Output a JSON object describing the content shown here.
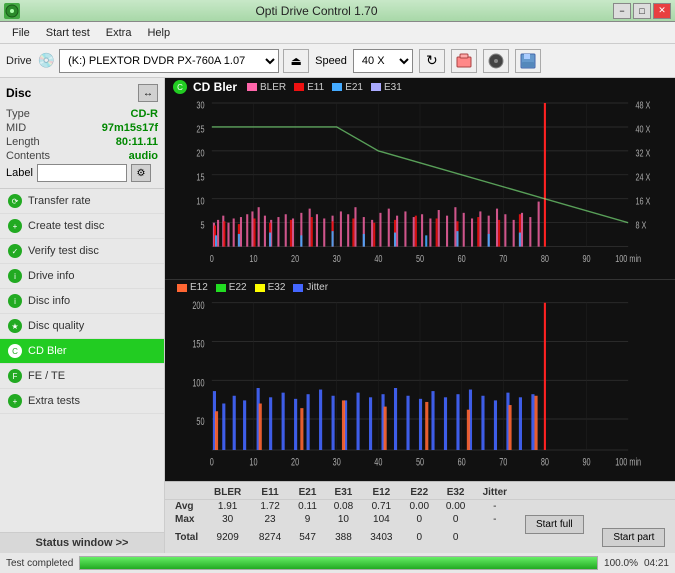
{
  "titlebar": {
    "title": "Opti Drive Control 1.70",
    "icon": "O",
    "min": "−",
    "max": "□",
    "close": "✕"
  },
  "menubar": {
    "items": [
      "File",
      "Start test",
      "Extra",
      "Help"
    ]
  },
  "toolbar": {
    "drive_label": "Drive",
    "drive_icon": "💿",
    "drive_value": "(K:)  PLEXTOR DVDR  PX-760A 1.07",
    "eject_icon": "⏏",
    "speed_label": "Speed",
    "speed_value": "40 X",
    "speed_icon": "↻",
    "copy_icon": "⊙",
    "burn_icon": "🔥",
    "save_icon": "💾"
  },
  "disc": {
    "header": "Disc",
    "refresh_icon": "↔",
    "type_label": "Type",
    "type_value": "CD-R",
    "mid_label": "MID",
    "mid_value": "97m15s17f",
    "length_label": "Length",
    "length_value": "80:11.11",
    "contents_label": "Contents",
    "contents_value": "audio",
    "label_label": "Label",
    "label_placeholder": "",
    "settings_icon": "⚙"
  },
  "nav": {
    "items": [
      {
        "id": "transfer-rate",
        "label": "Transfer rate",
        "active": false
      },
      {
        "id": "create-test-disc",
        "label": "Create test disc",
        "active": false
      },
      {
        "id": "verify-test-disc",
        "label": "Verify test disc",
        "active": false
      },
      {
        "id": "drive-info",
        "label": "Drive info",
        "active": false
      },
      {
        "id": "disc-info",
        "label": "Disc info",
        "active": false
      },
      {
        "id": "disc-quality",
        "label": "Disc quality",
        "active": false
      },
      {
        "id": "cd-bler",
        "label": "CD Bler",
        "active": true
      },
      {
        "id": "fe-te",
        "label": "FE / TE",
        "active": false
      },
      {
        "id": "extra-tests",
        "label": "Extra tests",
        "active": false
      }
    ]
  },
  "status_window": "Status window >>",
  "progress": {
    "text": "Test completed",
    "percent": "100.0%",
    "fill": 100,
    "time": "04:21"
  },
  "chart1": {
    "title": "CD Bler",
    "icon": "C",
    "legend": [
      {
        "label": "BLER",
        "color": "#ff66aa"
      },
      {
        "label": "E11",
        "color": "#ee1111"
      },
      {
        "label": "E21",
        "color": "#44aaff"
      },
      {
        "label": "E31",
        "color": "#aaaaff"
      }
    ],
    "y_max": 30,
    "x_max": 100,
    "right_axis": [
      "48 X",
      "40 X",
      "32 X",
      "24 X",
      "16 X",
      "8 X"
    ],
    "x_ticks": [
      "0",
      "10",
      "20",
      "30",
      "40",
      "50",
      "60",
      "70",
      "80",
      "90",
      "100 min"
    ],
    "y_ticks": [
      "30",
      "25",
      "20",
      "15",
      "10",
      "5",
      "0"
    ]
  },
  "chart2": {
    "legend": [
      {
        "label": "E12",
        "color": "#ff6633"
      },
      {
        "label": "E22",
        "color": "#22dd22"
      },
      {
        "label": "E32",
        "color": "#ffff00"
      },
      {
        "label": "Jitter",
        "color": "#4466ff"
      }
    ],
    "y_max": 200,
    "x_max": 100,
    "x_ticks": [
      "0",
      "10",
      "20",
      "30",
      "40",
      "50",
      "60",
      "70",
      "80",
      "90",
      "100 min"
    ],
    "y_ticks": [
      "200",
      "150",
      "100",
      "50",
      "0"
    ]
  },
  "table": {
    "headers": [
      "",
      "BLER",
      "E11",
      "E21",
      "E31",
      "E12",
      "E22",
      "E32",
      "Jitter",
      "",
      ""
    ],
    "rows": [
      {
        "label": "Avg",
        "bler": "1.91",
        "e11": "1.72",
        "e21": "0.11",
        "e31": "0.08",
        "e12": "0.71",
        "e22": "0.00",
        "e32": "0.00",
        "jitter": "-"
      },
      {
        "label": "Max",
        "bler": "30",
        "e11": "23",
        "e21": "9",
        "e31": "10",
        "e12": "104",
        "e22": "0",
        "e32": "0",
        "jitter": "-"
      },
      {
        "label": "Total",
        "bler": "9209",
        "e11": "8274",
        "e21": "547",
        "e31": "388",
        "e12": "3403",
        "e22": "0",
        "e32": "0",
        "jitter": ""
      }
    ],
    "start_full": "Start full",
    "start_part": "Start part"
  }
}
